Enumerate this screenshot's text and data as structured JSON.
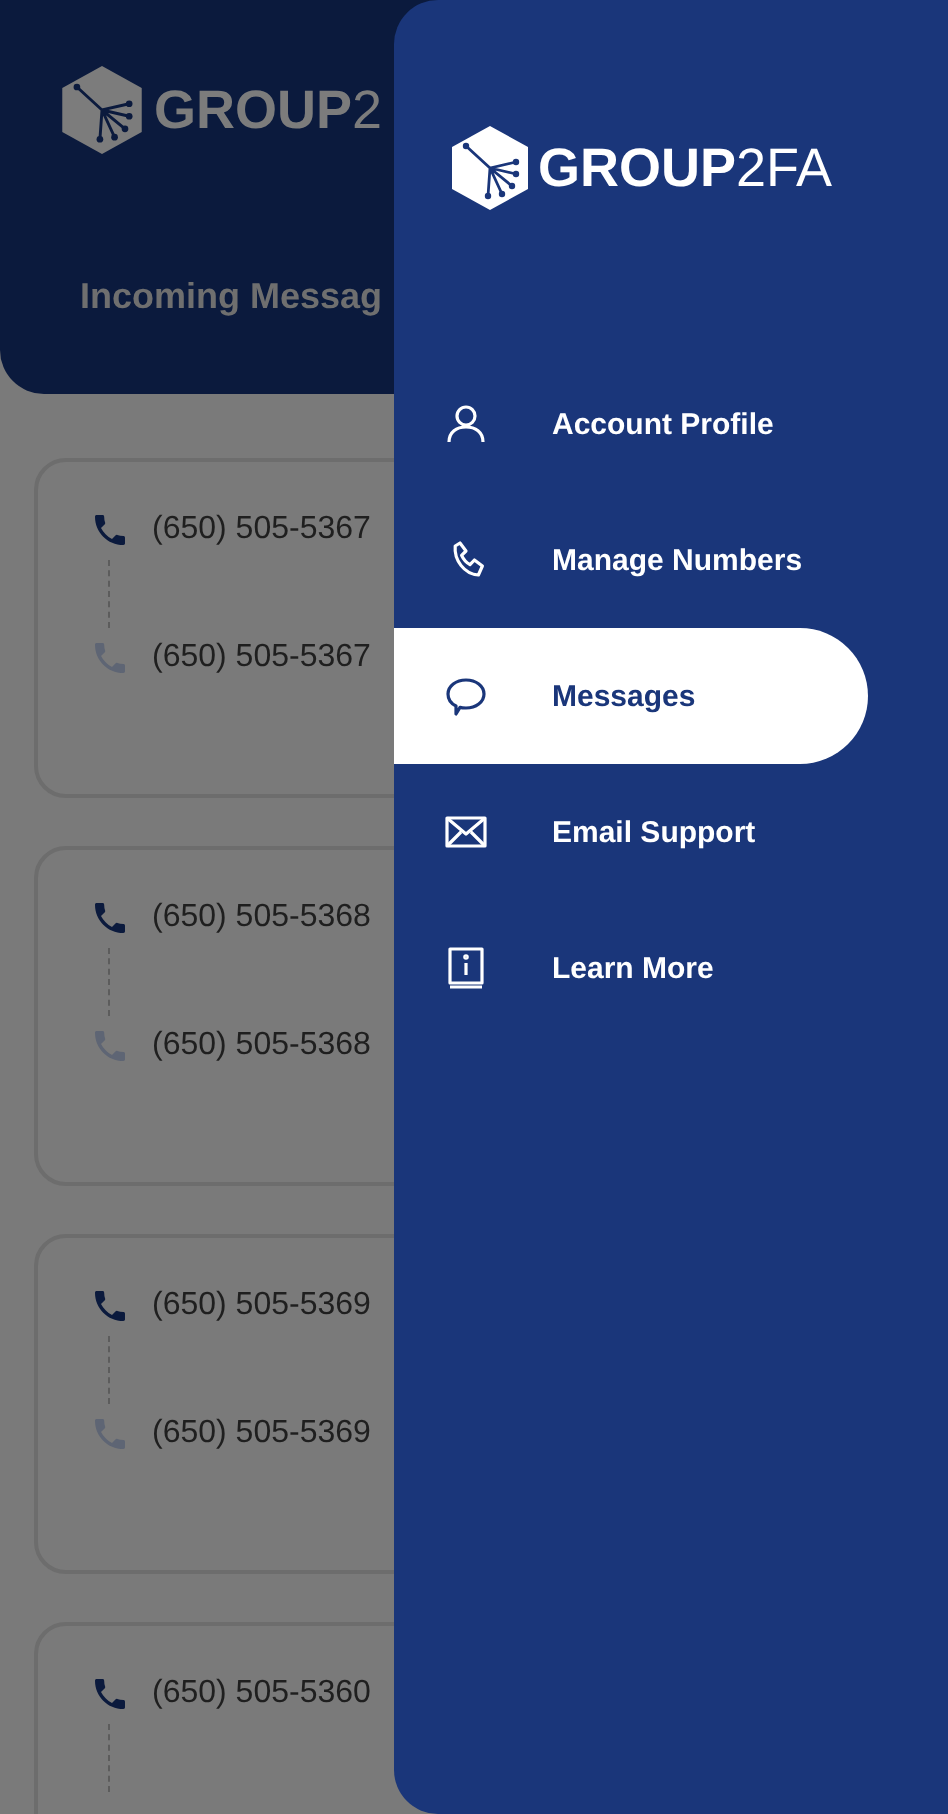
{
  "background_app": {
    "logo": {
      "bold": "GROUP",
      "light": "2"
    },
    "header_title": "Incoming Messag",
    "cards": [
      {
        "from": "(650) 505-5367",
        "to": "(650) 505-5367"
      },
      {
        "from": "(650) 505-5368",
        "to": "(650) 505-5368"
      },
      {
        "from": "(650) 505-5369",
        "to": "(650) 505-5369"
      },
      {
        "from": "(650) 505-5360"
      }
    ]
  },
  "drawer": {
    "logo": {
      "bold": "GROUP",
      "light": "2FA"
    },
    "items": [
      {
        "label": "Account Profile",
        "selected": false
      },
      {
        "label": "Manage Numbers",
        "selected": false
      },
      {
        "label": "Messages",
        "selected": true
      },
      {
        "label": "Email Support",
        "selected": false
      },
      {
        "label": "Learn More",
        "selected": false
      }
    ]
  }
}
